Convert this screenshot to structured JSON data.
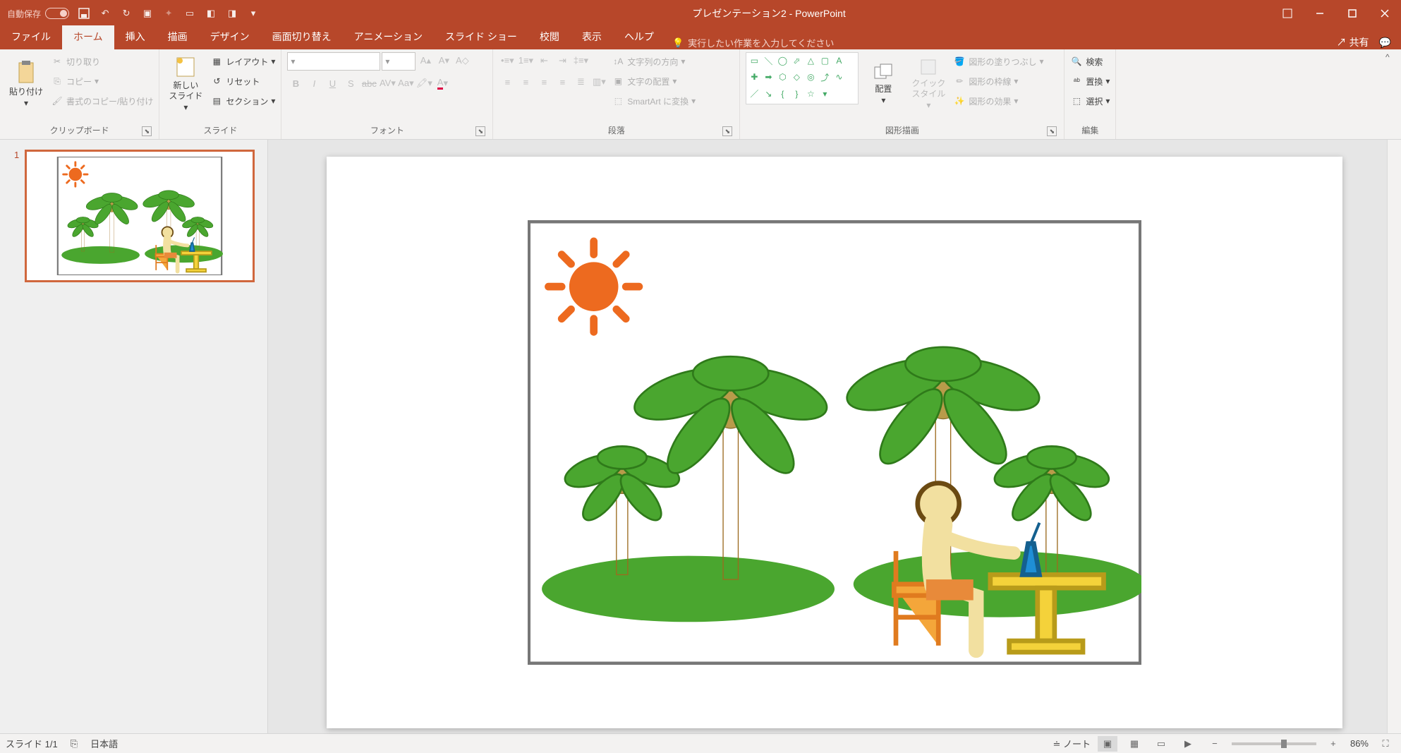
{
  "titlebar": {
    "autosave_label": "自動保存",
    "autosave_state": "オフ",
    "title": "プレゼンテーション2 - PowerPoint"
  },
  "tabs": {
    "file": "ファイル",
    "home": "ホーム",
    "insert": "挿入",
    "draw": "描画",
    "design": "デザイン",
    "transitions": "画面切り替え",
    "animations": "アニメーション",
    "slideshow": "スライド ショー",
    "review": "校閲",
    "view": "表示",
    "help": "ヘルプ",
    "tellme_placeholder": "実行したい作業を入力してください",
    "share": "共有"
  },
  "ribbon": {
    "clipboard": {
      "label": "クリップボード",
      "paste": "貼り付け",
      "cut": "切り取り",
      "copy": "コピー",
      "format_painter": "書式のコピー/貼り付け"
    },
    "slides": {
      "label": "スライド",
      "new_slide": "新しい\nスライド",
      "layout": "レイアウト",
      "reset": "リセット",
      "section": "セクション"
    },
    "font": {
      "label": "フォント"
    },
    "paragraph": {
      "label": "段落",
      "text_dir": "文字列の方向",
      "align_text": "文字の配置",
      "smartart": "SmartArt に変換"
    },
    "drawing": {
      "label": "図形描画",
      "arrange": "配置",
      "quick_styles": "クイック\nスタイル",
      "shape_fill": "図形の塗りつぶし",
      "shape_outline": "図形の枠線",
      "shape_effects": "図形の効果"
    },
    "editing": {
      "label": "編集",
      "find": "検索",
      "replace": "置換",
      "select": "選択"
    }
  },
  "thumbnails": {
    "slide1_num": "1"
  },
  "statusbar": {
    "slide_indicator": "スライド 1/1",
    "language": "日本語",
    "notes": "ノート",
    "zoom_pct": "86%"
  }
}
